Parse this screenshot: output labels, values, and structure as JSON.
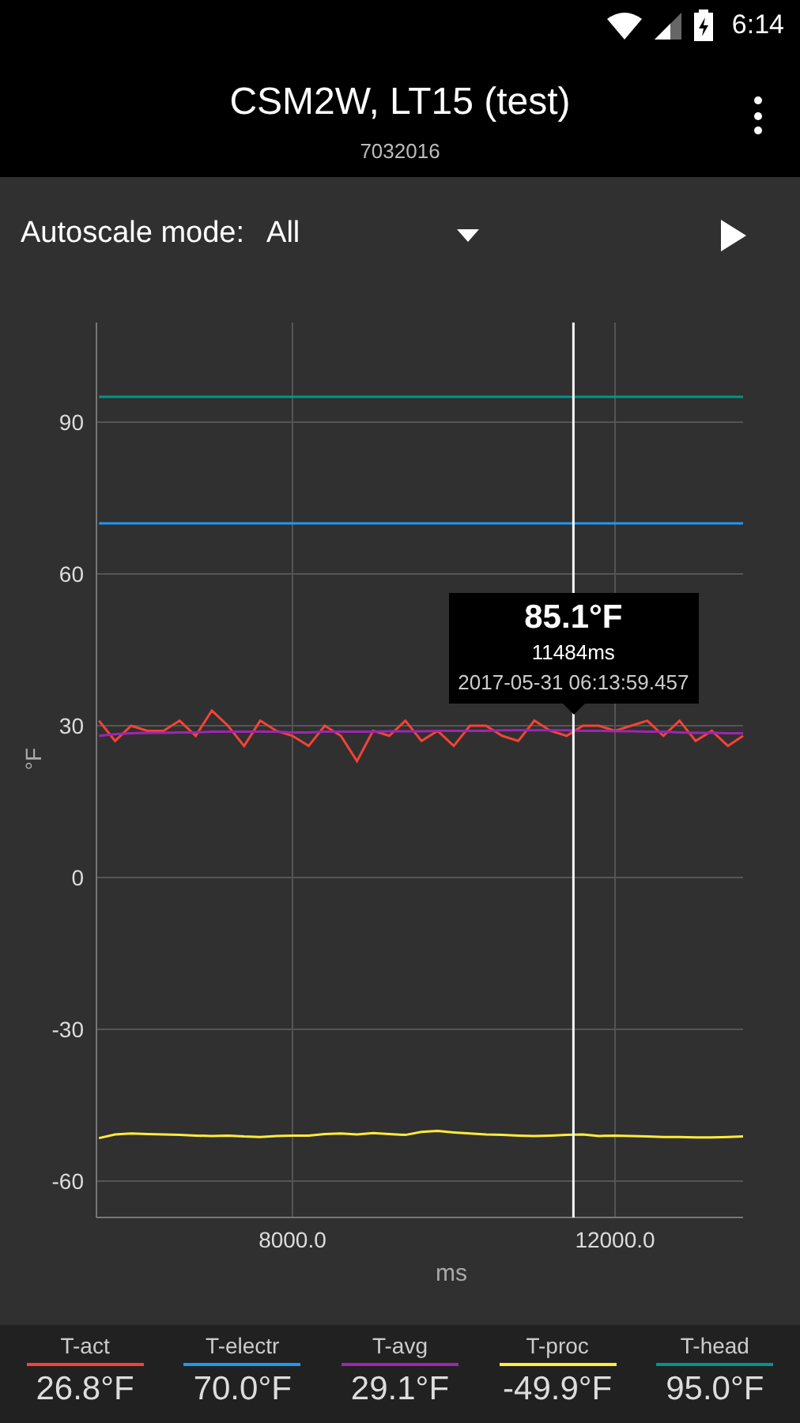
{
  "status_bar": {
    "time": "6:14"
  },
  "app_bar": {
    "title": "CSM2W, LT15 (test)",
    "subtitle": "7032016"
  },
  "controls": {
    "label": "Autoscale mode:",
    "dropdown": {
      "value": "All"
    }
  },
  "chart": {
    "chart_data": {
      "type": "line",
      "xlabel": "ms",
      "ylabel": "°F",
      "xlim": [
        5569,
        13588
      ],
      "ylim": [
        -67.2,
        109.7
      ],
      "xticks": [
        {
          "value": 8000,
          "label": "8000.0"
        },
        {
          "value": 12000,
          "label": "12000.0"
        }
      ],
      "yticks": [
        90,
        60,
        30,
        0,
        -30,
        -60
      ],
      "x": [
        5600,
        5800,
        6000,
        6200,
        6400,
        6600,
        6800,
        7000,
        7200,
        7400,
        7600,
        7800,
        8000,
        8200,
        8400,
        8600,
        8800,
        9000,
        9200,
        9400,
        9600,
        9800,
        10000,
        10200,
        10400,
        10600,
        10800,
        11000,
        11200,
        11400,
        11600,
        11800,
        12000,
        12200,
        12400,
        12600,
        12800,
        13000,
        13200,
        13400,
        13588
      ],
      "series": [
        {
          "name": "T-act",
          "color": "#f44336",
          "values": [
            31,
            27,
            30,
            29,
            29,
            31,
            28,
            33,
            30,
            26,
            31,
            29,
            28,
            26,
            30,
            28,
            23,
            29,
            28,
            31,
            27,
            29,
            26,
            30,
            30,
            28,
            27,
            31,
            29,
            28,
            30,
            30,
            29,
            30,
            31,
            28,
            31,
            27,
            29,
            26,
            28
          ]
        },
        {
          "name": "T-electr",
          "color": "#2196f3",
          "values": [
            70,
            70,
            70,
            70,
            70,
            70,
            70,
            70,
            70,
            70,
            70,
            70,
            70,
            70,
            70,
            70,
            70,
            70,
            70,
            70,
            70,
            70,
            70,
            70,
            70,
            70,
            70,
            70,
            70,
            70,
            70,
            70,
            70,
            70,
            70,
            70,
            70,
            70,
            70,
            70,
            70
          ]
        },
        {
          "name": "T-avg",
          "color": "#9c27b0",
          "values": [
            28,
            28.3,
            28.5,
            28.6,
            28.6,
            28.7,
            28.7,
            28.8,
            28.8,
            28.8,
            28.8,
            28.8,
            28.7,
            28.7,
            28.8,
            28.8,
            28.8,
            28.8,
            28.9,
            28.9,
            28.9,
            29,
            29,
            29,
            29,
            29.1,
            29.1,
            29.1,
            29.1,
            29.1,
            29,
            29,
            28.9,
            28.9,
            28.8,
            28.8,
            28.7,
            28.6,
            28.6,
            28.5,
            28.5
          ]
        },
        {
          "name": "T-proc",
          "color": "#ffeb3b",
          "values": [
            -51.5,
            -50.8,
            -50.6,
            -50.7,
            -50.8,
            -50.9,
            -51,
            -51.1,
            -51,
            -51.2,
            -51.3,
            -51.1,
            -51,
            -51,
            -50.7,
            -50.6,
            -50.8,
            -50.5,
            -50.7,
            -50.9,
            -50.3,
            -50.1,
            -50.4,
            -50.6,
            -50.8,
            -50.9,
            -51,
            -51.1,
            -51,
            -50.9,
            -50.8,
            -51.1,
            -51,
            -51.1,
            -51.2,
            -51.3,
            -51.3,
            -51.4,
            -51.4,
            -51.3,
            -51.2
          ]
        },
        {
          "name": "T-head",
          "color": "#009688",
          "values": [
            95,
            95,
            95,
            95,
            95,
            95,
            95,
            95,
            95,
            95,
            95,
            95,
            95,
            95,
            95,
            95,
            95,
            95,
            95,
            95,
            95,
            95,
            95,
            95,
            95,
            95,
            95,
            95,
            95,
            95,
            95,
            95,
            95,
            95,
            95,
            95,
            95,
            95,
            95,
            95,
            95
          ]
        }
      ],
      "grid": true,
      "ref_lines": [
        {
          "axis": "x",
          "value": 11484,
          "color": "#ffffff"
        }
      ]
    },
    "tooltip": {
      "value": "85.1°F",
      "time": "11484ms",
      "timestamp": "2017-05-31 06:13:59.457"
    }
  },
  "legend_values": [
    "26.8°F",
    "70.0°F",
    "29.1°F",
    "-49.9°F",
    "95.0°F"
  ]
}
